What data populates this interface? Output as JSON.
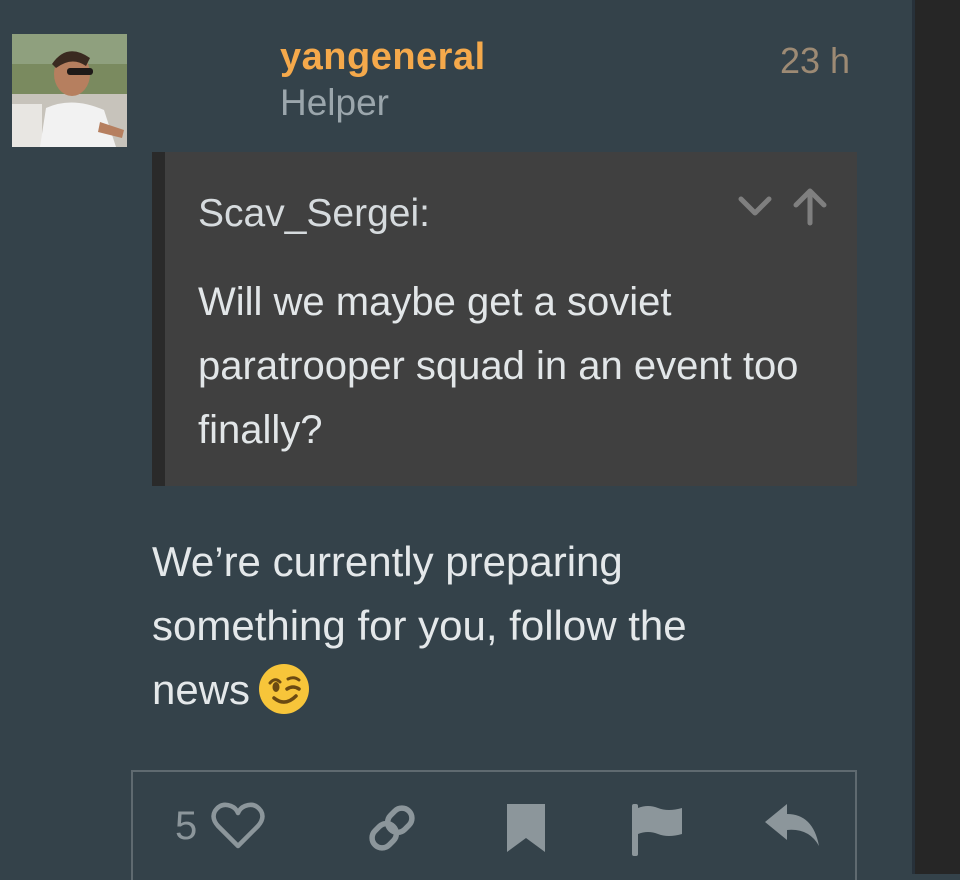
{
  "post": {
    "username": "yangeneral",
    "user_title": "Helper",
    "timestamp": "23 h",
    "quote": {
      "author": "Scav_Sergei:",
      "text": "Will we maybe get a soviet paratrooper squad in an event too finally?"
    },
    "body": "We’re currently preparing something for you, follow the news",
    "emoji": "winking-face",
    "like_count": "5"
  },
  "colors": {
    "background": "#34424a",
    "username": "#f5a94b",
    "timestamp": "#9d8a74",
    "quote_bg": "#404040"
  },
  "icons": [
    "chevron-down-icon",
    "arrow-up-icon",
    "heart-icon",
    "link-icon",
    "bookmark-icon",
    "flag-icon",
    "reply-icon"
  ]
}
